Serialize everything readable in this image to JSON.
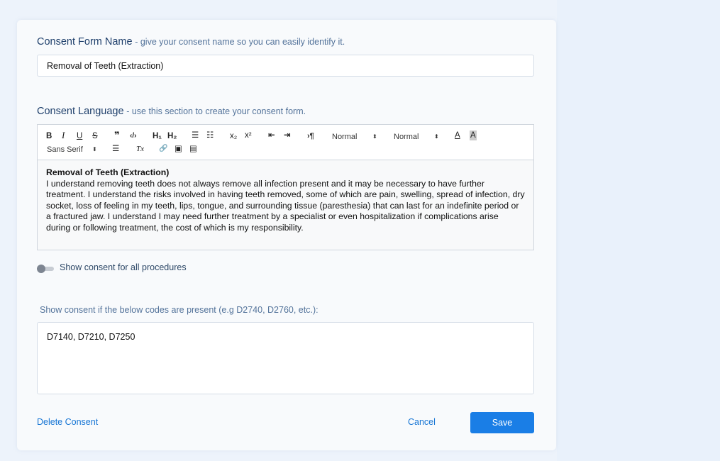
{
  "form": {
    "name_label": "Consent Form Name",
    "name_hint": "- give your consent name so you can easily identify it.",
    "name_value": "Removal of Teeth (Extraction)",
    "language_label": "Consent Language",
    "language_hint": "- use this section to create your consent form.",
    "toggle_label": "Show consent for all procedures",
    "toggle_on": false,
    "codes_label": "Show consent if the below codes are present (e.g D2740, D2760, etc.):",
    "codes_value": "D7140, D7210, D7250"
  },
  "toolbar": {
    "bold": "B",
    "italic": "I",
    "underline": "U",
    "strike": "S",
    "blockquote": "❞",
    "code": "‹/›",
    "h1": "H₁",
    "h2": "H₂",
    "ordered_list": "☰",
    "bullet_list": "☷",
    "subscript": "x₂",
    "superscript": "x²",
    "outdent": "⇤",
    "indent": "⇥",
    "direction": "›¶",
    "size_select": "Normal",
    "header_select": "Normal",
    "font_color": "A",
    "background_color": "A",
    "font_select": "Sans Serif",
    "align": "☰",
    "clean": "Tx",
    "link": "🔗",
    "image": "▣",
    "video": "▤",
    "caret": "⬍"
  },
  "editor": {
    "title": "Removal of Teeth (Extraction)",
    "body": "I understand removing teeth does not always remove all infection present and it may be necessary to have further treatment. I understand the risks involved in having teeth removed, some of which are pain, swelling, spread of infection, dry socket, loss of feeling in my teeth, lips, tongue, and surrounding tissue (paresthesia) that can last for an indefinite period or a fractured jaw. I understand I may need further treatment by a specialist or even hospitalization if complications arise during or following treatment, the cost of which is my responsibility."
  },
  "actions": {
    "delete": "Delete Consent",
    "cancel": "Cancel",
    "save": "Save"
  },
  "colors": {
    "primary": "#1a7ee6",
    "link": "#1474d4",
    "label": "#1e3f6b"
  }
}
